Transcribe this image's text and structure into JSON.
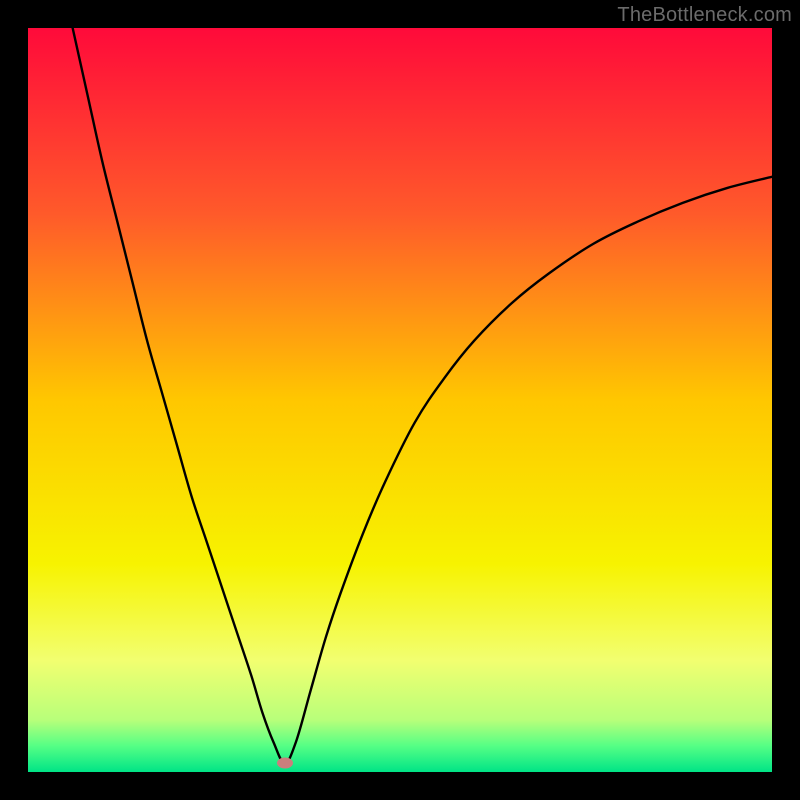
{
  "watermark": "TheBottleneck.com",
  "chart_data": {
    "type": "line",
    "title": "",
    "xlabel": "",
    "ylabel": "",
    "xlim": [
      0,
      100
    ],
    "ylim": [
      0,
      100
    ],
    "grid": false,
    "legend": false,
    "background": {
      "type": "vertical-gradient",
      "stops": [
        {
          "pos": 0.0,
          "color": "#ff0a3a"
        },
        {
          "pos": 0.25,
          "color": "#ff5a2a"
        },
        {
          "pos": 0.5,
          "color": "#ffc700"
        },
        {
          "pos": 0.72,
          "color": "#f7f300"
        },
        {
          "pos": 0.85,
          "color": "#f2ff70"
        },
        {
          "pos": 0.93,
          "color": "#b8ff7a"
        },
        {
          "pos": 0.965,
          "color": "#55ff85"
        },
        {
          "pos": 1.0,
          "color": "#00e486"
        }
      ]
    },
    "series": [
      {
        "name": "bottleneck-curve",
        "color": "#000000",
        "x": [
          6,
          8,
          10,
          12,
          14,
          16,
          18,
          20,
          22,
          24,
          26,
          28,
          30,
          31.5,
          33,
          34.5,
          36,
          38,
          40,
          42,
          45,
          48,
          52,
          56,
          60,
          65,
          70,
          76,
          82,
          88,
          94,
          100
        ],
        "y": [
          100,
          91,
          82,
          74,
          66,
          58,
          51,
          44,
          37,
          31,
          25,
          19,
          13,
          8,
          4,
          1.2,
          4,
          11,
          18,
          24,
          32,
          39,
          47,
          53,
          58,
          63,
          67,
          71,
          74,
          76.5,
          78.5,
          80
        ]
      }
    ],
    "marker": {
      "x": 34.5,
      "y": 1.2,
      "color": "#c97f7d"
    }
  }
}
